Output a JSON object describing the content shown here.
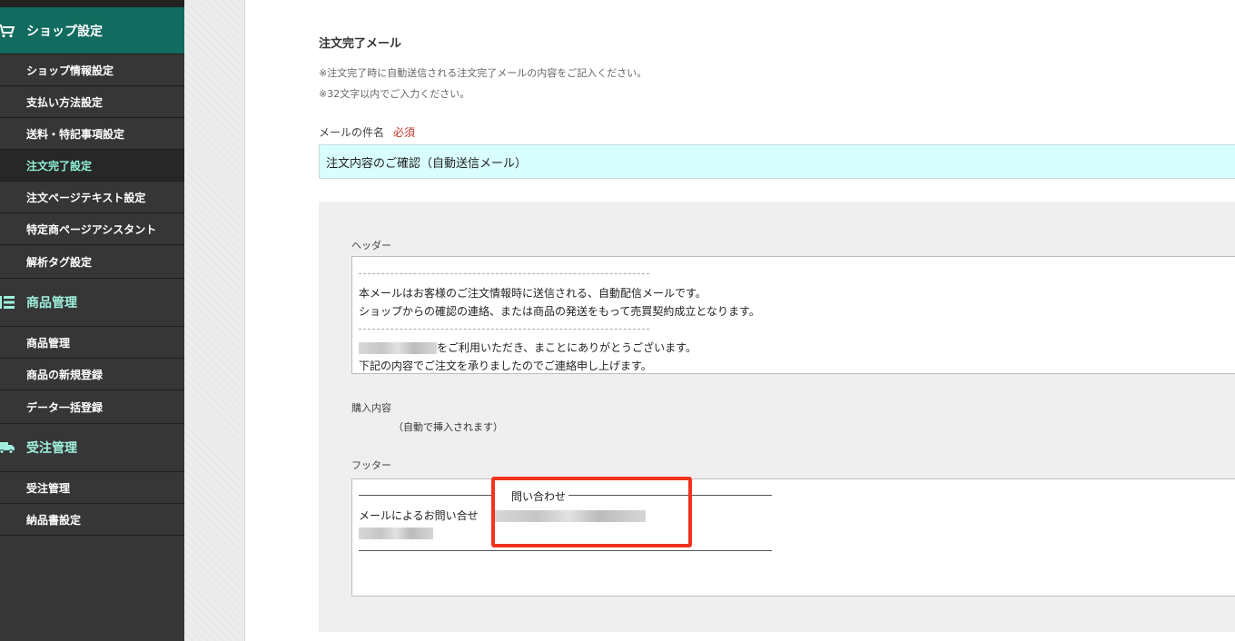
{
  "sidebar": {
    "sections": [
      {
        "title": "ショップ設定",
        "icon": "cart-icon",
        "items": [
          "ショップ情報設定",
          "支払い方法設定",
          "送料・特記事項設定",
          "注文完了設定",
          "注文ページテキスト設定",
          "特定商ページアシスタント",
          "解析タグ設定"
        ],
        "current": "注文完了設定"
      },
      {
        "title": "商品管理",
        "icon": "product-list-icon",
        "items": [
          "商品管理",
          "商品の新規登録",
          "データ一括登録"
        ]
      },
      {
        "title": "受注管理",
        "icon": "truck-icon",
        "items": [
          "受注管理",
          "納品書設定"
        ]
      }
    ]
  },
  "main": {
    "title": "注文完了メール",
    "notes": [
      "※注文完了時に自動送信される注文完了メールの内容をご記入ください。",
      "※32文字以内でご入力ください。"
    ],
    "subject_label": "メールの件名",
    "required_label": "必須",
    "subject_value": "注文内容のご確認（自動送信メール）",
    "header_label": "ヘッダー",
    "header_lines": [
      "本メールはお客様のご注文情報時に送信される、自動配信メールです。",
      "ショップからの確認の連絡、または商品の発送をもって売買契約成立となります。",
      "をご利用いただき、まことにありがとうございます。",
      "下記の内容でご注文を承りましたのでご連絡申し上げます。"
    ],
    "purchase_label": "購入内容",
    "purchase_auto": "（自動で挿入されます）",
    "footer_label": "フッター",
    "footer_heading": "問い合わせ",
    "footer_line": "メールによるお問い合せ"
  },
  "colors": {
    "accent": "#126b5f",
    "active_text": "#8ff2d6",
    "subject_bg": "#d9feff",
    "highlight": "#f1331f",
    "required": "#c0392b"
  }
}
